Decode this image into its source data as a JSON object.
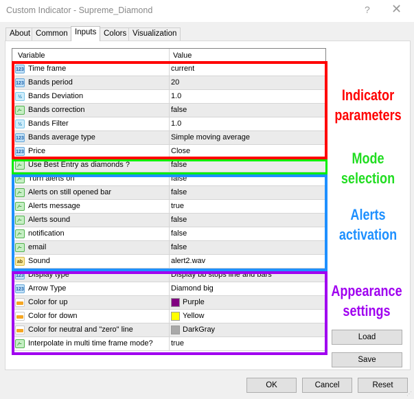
{
  "window": {
    "title": "Custom Indicator - Supreme_Diamond",
    "help_glyph": "?",
    "close_glyph": "✕"
  },
  "tabs": [
    {
      "label": "About",
      "active": false
    },
    {
      "label": "Common",
      "active": false
    },
    {
      "label": "Inputs",
      "active": true
    },
    {
      "label": "Colors",
      "active": false
    },
    {
      "label": "Visualization",
      "active": false
    }
  ],
  "grid": {
    "headers": {
      "variable": "Variable",
      "value": "Value"
    },
    "rows": [
      {
        "icon": "int-icon",
        "type": "int",
        "name": "Time frame",
        "value": "current"
      },
      {
        "icon": "int-icon",
        "type": "int",
        "name": "Bands period",
        "value": "20"
      },
      {
        "icon": "double-icon",
        "type": "dbl",
        "name": "Bands Deviation",
        "value": "1.0"
      },
      {
        "icon": "bool-icon",
        "type": "bool",
        "name": "Bands correction",
        "value": "false"
      },
      {
        "icon": "double-icon",
        "type": "dbl",
        "name": "Bands Filter",
        "value": "1.0"
      },
      {
        "icon": "int-icon",
        "type": "int",
        "name": "Bands average type",
        "value": "Simple moving average"
      },
      {
        "icon": "int-icon",
        "type": "int",
        "name": "Price",
        "value": "Close"
      },
      {
        "icon": "bool-icon",
        "type": "bool",
        "name": "Use Best Entry as diamonds ?",
        "value": "false"
      },
      {
        "icon": "bool-icon",
        "type": "bool",
        "name": "Turn alerts on",
        "value": "false"
      },
      {
        "icon": "bool-icon",
        "type": "bool",
        "name": "Alerts on still opened bar",
        "value": "false"
      },
      {
        "icon": "bool-icon",
        "type": "bool",
        "name": "Alerts message",
        "value": "true"
      },
      {
        "icon": "bool-icon",
        "type": "bool",
        "name": "Alerts sound",
        "value": "false"
      },
      {
        "icon": "bool-icon",
        "type": "bool",
        "name": "notification",
        "value": "false"
      },
      {
        "icon": "bool-icon",
        "type": "bool",
        "name": "email",
        "value": "false"
      },
      {
        "icon": "string-icon",
        "type": "str",
        "name": "Sound",
        "value": "alert2.wav"
      },
      {
        "icon": "int-icon",
        "type": "int",
        "name": "Display type",
        "value": "Display bb stops line and bars"
      },
      {
        "icon": "int-icon",
        "type": "int",
        "name": "Arrow Type",
        "value": "Diamond big"
      },
      {
        "icon": "color-icon",
        "type": "clr",
        "name": "Color for up",
        "value": "Purple",
        "swatch": "#800080"
      },
      {
        "icon": "color-icon",
        "type": "clr",
        "name": "Color for down",
        "value": "Yellow",
        "swatch": "#ffff00"
      },
      {
        "icon": "color-icon",
        "type": "clr",
        "name": "Color for neutral and \"zero\" line",
        "value": "DarkGray",
        "swatch": "#a9a9a9"
      },
      {
        "icon": "bool-icon",
        "type": "bool",
        "name": "Interpolate in multi time frame mode?",
        "value": "true"
      }
    ]
  },
  "annotations": [
    {
      "label": "Indicator parameters",
      "color": "#ff0000"
    },
    {
      "label": "Mode selection",
      "color": "#22dd22"
    },
    {
      "label": "Alerts activation",
      "color": "#1e90ff"
    },
    {
      "label": "Appearance settings",
      "color": "#a000f0"
    }
  ],
  "buttons": {
    "load": "Load",
    "save": "Save",
    "ok": "OK",
    "cancel": "Cancel",
    "reset": "Reset"
  }
}
